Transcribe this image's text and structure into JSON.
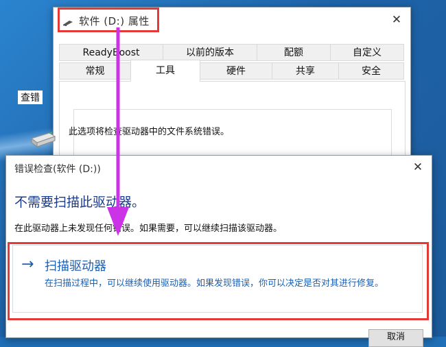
{
  "properties_window": {
    "title": "软件 (D:) 属性",
    "close_glyph": "✕",
    "tabs_row1": [
      "ReadyBoost",
      "以前的版本",
      "配额",
      "自定义"
    ],
    "tabs_row2": [
      "常规",
      "工具",
      "硬件",
      "共享",
      "安全"
    ],
    "active_tab": "工具",
    "group_label": "查错",
    "group_description": "此选项将检查驱动器中的文件系统错误。"
  },
  "error_check_dialog": {
    "title": "错误检查(软件 (D:))",
    "close_glyph": "✕",
    "heading": "不需要扫描此驱动器。",
    "message": "在此驱动器上未发现任何错误。如果需要，可以继续扫描该驱动器。",
    "scan_option": {
      "arrow_glyph": "→",
      "label": "扫描驱动器",
      "description": "在扫描过程中，可以继续使用驱动器。如果发现错误，你可以决定是否对其进行修复。"
    },
    "cancel_button": "取消"
  },
  "annotations": {
    "highlight_color": "#e53935",
    "arrow_color": "#cc33e6"
  }
}
